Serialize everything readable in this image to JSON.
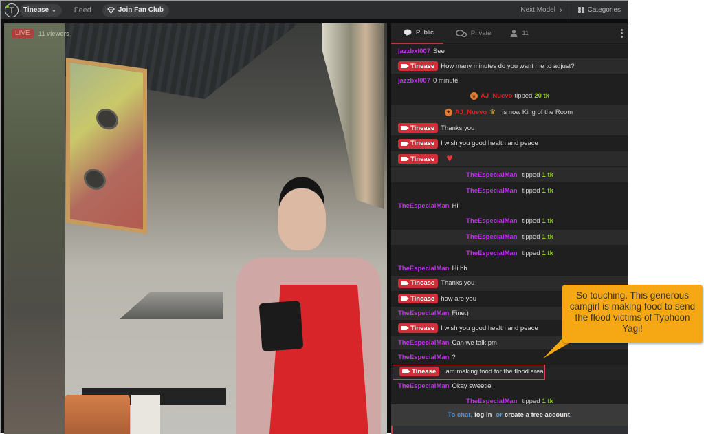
{
  "topbar": {
    "avatar_letter": "T",
    "model_name": "Tinease",
    "feed_label": "Feed",
    "fan_club_label": "Join Fan Club",
    "next_model_label": "Next Model",
    "categories_label": "Categories"
  },
  "video": {
    "live_label": "LIVE",
    "viewers_label": "11 viewers"
  },
  "chat": {
    "tabs": [
      {
        "label": "Public",
        "icon": "chat-bubble-icon",
        "active": true
      },
      {
        "label": "Private",
        "icon": "private-chat-icon",
        "active": false
      },
      {
        "label": "11",
        "icon": "user-icon",
        "active": false
      }
    ],
    "messages": [
      {
        "type": "user",
        "user": "jazzbxl007",
        "text": "See"
      },
      {
        "type": "model",
        "user": "Tinease",
        "text": "How many minutes do you want me to adjust?"
      },
      {
        "type": "user",
        "user": "jazzbxl007",
        "text": "0 minute"
      },
      {
        "type": "tip",
        "user": "AJ_Nuevo",
        "verb": "tipped",
        "amount": "20 tk"
      },
      {
        "type": "king",
        "user": "AJ_Nuevo",
        "text": "is now King of the Room"
      },
      {
        "type": "model",
        "user": "Tinease",
        "text": "Thanks you"
      },
      {
        "type": "model",
        "user": "Tinease",
        "text": "I wish you good health and peace"
      },
      {
        "type": "model",
        "user": "Tinease",
        "text": "heart-emoji"
      },
      {
        "type": "tip",
        "user": "TheEspecialMan",
        "verb": "tipped",
        "amount": "1 tk"
      },
      {
        "type": "tip",
        "user": "TheEspecialMan",
        "verb": "tipped",
        "amount": "1 tk"
      },
      {
        "type": "user",
        "user": "TheEspecialMan",
        "text": "Hi"
      },
      {
        "type": "tip",
        "user": "TheEspecialMan",
        "verb": "tipped",
        "amount": "1 tk"
      },
      {
        "type": "tip",
        "user": "TheEspecialMan",
        "verb": "tipped",
        "amount": "1 tk"
      },
      {
        "type": "tip",
        "user": "TheEspecialMan",
        "verb": "tipped",
        "amount": "1 tk"
      },
      {
        "type": "user",
        "user": "TheEspecialMan",
        "text": "Hi bb"
      },
      {
        "type": "model",
        "user": "Tinease",
        "text": "Thanks you"
      },
      {
        "type": "model",
        "user": "Tinease",
        "text": "how are you"
      },
      {
        "type": "user",
        "user": "TheEspecialMan",
        "text": "Fine:)"
      },
      {
        "type": "model",
        "user": "Tinease",
        "text": "I wish you good health and peace"
      },
      {
        "type": "user",
        "user": "TheEspecialMan",
        "text": "Can we talk pm"
      },
      {
        "type": "user",
        "user": "TheEspecialMan",
        "text": "?"
      },
      {
        "type": "model",
        "user": "Tinease",
        "text": "I am making food for the flood area",
        "highlighted": true
      },
      {
        "type": "user",
        "user": "TheEspecialMan",
        "text": "Okay sweetie"
      },
      {
        "type": "tip",
        "user": "TheEspecialMan",
        "verb": "tipped",
        "amount": "1 tk"
      }
    ],
    "login_prompt": {
      "to_chat": "To chat,",
      "log_in": "log in",
      "or": "or",
      "create_account": "create a free account",
      "period": "."
    }
  },
  "annotation": {
    "text": "So touching. This generous camgirl is making food to send the flood victims of Typhoon Yagi!",
    "color": "#f5a814"
  },
  "colors": {
    "username_purple": "#bd32e8",
    "model_tag_red": "#cf3039",
    "tip_green": "#94d11e",
    "king_red": "#e4201c",
    "link_blue": "#4d94d6"
  }
}
